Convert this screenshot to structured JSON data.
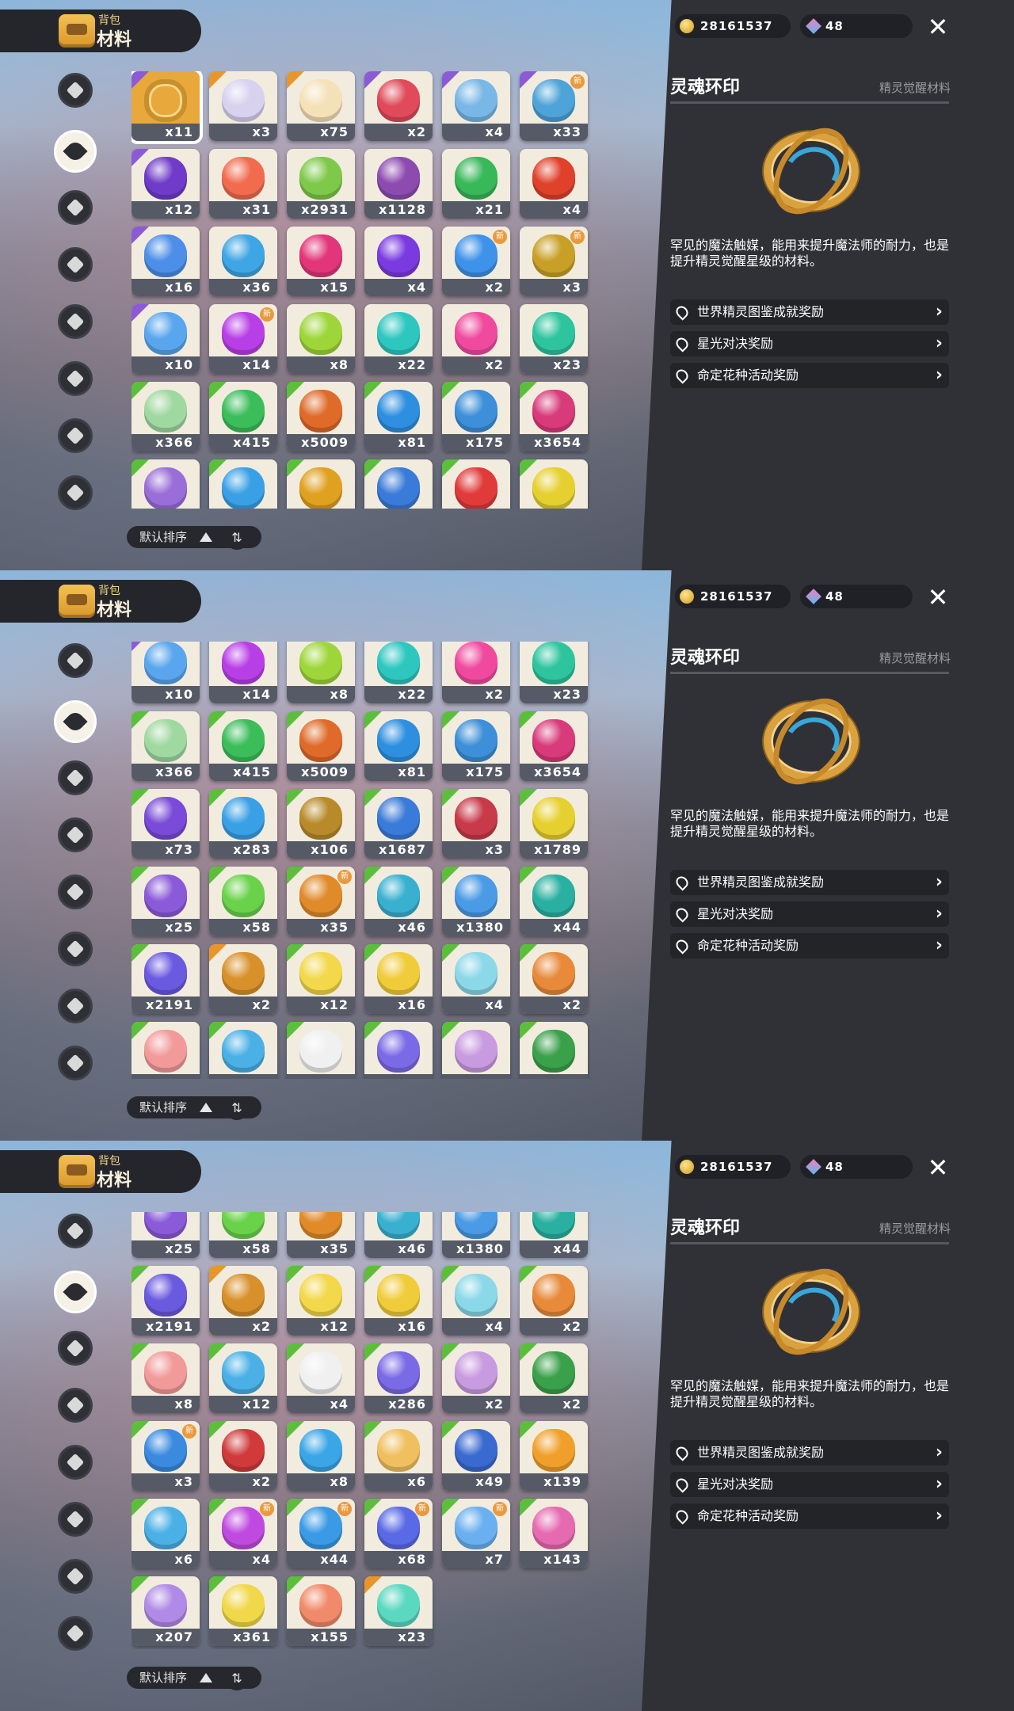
{
  "header": {
    "sub_label": "背包",
    "main_label": "材料"
  },
  "currency": {
    "coins": "28161537",
    "gems": "48"
  },
  "sort": {
    "label": "默认排序"
  },
  "detail": {
    "title": "灵魂环印",
    "category": "精灵觉醒材料",
    "description": "罕见的魔法触媒，能用来提升魔法师的耐力，也是提升精灵觉醒星级的材料。",
    "sources": [
      "世界精灵图鉴成就奖励",
      "星光对决奖励",
      "命定花种活动奖励"
    ]
  },
  "sidebar_icons": [
    "star-icon",
    "leaf-icon",
    "sparkle-icon",
    "plant-icon",
    "crown-icon",
    "ball-icon",
    "acorn-icon",
    "helmet-icon"
  ],
  "panels": [
    {
      "rows": [
        [
          [
            "x11",
            "#d9a23e",
            "purple",
            "sel",
            "ring"
          ],
          [
            "x3",
            "#d8d2ef",
            "orange"
          ],
          [
            "x75",
            "#f4e1b8",
            "orange"
          ],
          [
            "x2",
            "#e04a5a",
            "purple"
          ],
          [
            "x4",
            "#78b7e6",
            "purple"
          ],
          [
            "x33",
            "#4ea3d8",
            "purple",
            "new"
          ]
        ],
        [
          [
            "x12",
            "#6f3bc8",
            "purple"
          ],
          [
            "x31",
            "#f26b4f",
            ""
          ],
          [
            "x2931",
            "#7ec94a",
            ""
          ],
          [
            "x1128",
            "#8d4bb0",
            ""
          ],
          [
            "x21",
            "#39b85a",
            ""
          ],
          [
            "x4",
            "#e0412a",
            ""
          ]
        ],
        [
          [
            "x16",
            "#4c8ee8",
            "purple"
          ],
          [
            "x36",
            "#3ea6e4",
            ""
          ],
          [
            "x15",
            "#e2357a",
            ""
          ],
          [
            "x4",
            "#7a3ae0",
            ""
          ],
          [
            "x2",
            "#3f92ea",
            "",
            "new"
          ],
          [
            "x3",
            "#c8a028",
            "",
            "new"
          ]
        ],
        [
          [
            "x10",
            "#5aa6ee",
            "purple"
          ],
          [
            "x14",
            "#b83ee6",
            "",
            "new"
          ],
          [
            "x8",
            "#9ed63a",
            ""
          ],
          [
            "x22",
            "#2ec7c0",
            ""
          ],
          [
            "x2",
            "#f04a9e",
            ""
          ],
          [
            "x23",
            "#2ec49e",
            ""
          ]
        ],
        [
          [
            "x366",
            "#9fd8a0",
            "green"
          ],
          [
            "x415",
            "#3bbd5a",
            "green"
          ],
          [
            "x5009",
            "#e06a2a",
            "green"
          ],
          [
            "x81",
            "#2e8fe0",
            "green"
          ],
          [
            "x175",
            "#3c8fd8",
            "green"
          ],
          [
            "x3654",
            "#d83a7a",
            "green"
          ]
        ],
        [
          [
            "",
            "#9a6ed8",
            "green"
          ],
          [
            "",
            "#3aa0e6",
            "green"
          ],
          [
            "",
            "#e0a020",
            "green"
          ],
          [
            "",
            "#3a7ad8",
            "green"
          ],
          [
            "",
            "#e03a3a",
            "green"
          ],
          [
            "",
            "#e6d030",
            "green"
          ]
        ]
      ]
    },
    {
      "rows": [
        [
          [
            "x10",
            "#5aa6ee",
            "purple"
          ],
          [
            "x14",
            "#b83ee6",
            ""
          ],
          [
            "x8",
            "#9ed63a",
            ""
          ],
          [
            "x22",
            "#2ec7c0",
            ""
          ],
          [
            "x2",
            "#f04a9e",
            ""
          ],
          [
            "x23",
            "#2ec49e",
            ""
          ]
        ],
        [
          [
            "x366",
            "#9fd8a0",
            "green"
          ],
          [
            "x415",
            "#3bbd5a",
            "green"
          ],
          [
            "x5009",
            "#e06a2a",
            "green"
          ],
          [
            "x81",
            "#2e8fe0",
            "green"
          ],
          [
            "x175",
            "#3c8fd8",
            "green"
          ],
          [
            "x3654",
            "#d83a7a",
            "green"
          ]
        ],
        [
          [
            "x73",
            "#7a4ad8",
            "green"
          ],
          [
            "x283",
            "#3aa0e6",
            "green"
          ],
          [
            "x106",
            "#b88a2a",
            "green"
          ],
          [
            "x1687",
            "#3a7ad8",
            "green"
          ],
          [
            "x3",
            "#c83a4a",
            "green"
          ],
          [
            "x1789",
            "#e6d030",
            "green"
          ]
        ],
        [
          [
            "x25",
            "#8a5ad8",
            "green"
          ],
          [
            "x58",
            "#6ad24a",
            "green"
          ],
          [
            "x35",
            "#e08a2a",
            "green",
            "new"
          ],
          [
            "x46",
            "#3ab0d0",
            "green"
          ],
          [
            "x1380",
            "#4a9ae6",
            "green"
          ],
          [
            "x44",
            "#2ab0a0",
            "green"
          ]
        ],
        [
          [
            "x2191",
            "#6a5ae0",
            "green"
          ],
          [
            "x2",
            "#d8902a",
            "orange"
          ],
          [
            "x12",
            "#f2d84a",
            "green"
          ],
          [
            "x16",
            "#f0cc3a",
            "green"
          ],
          [
            "x4",
            "#8ad8e8",
            "green"
          ],
          [
            "x2",
            "#e88a3a",
            "green"
          ]
        ],
        [
          [
            "",
            "#f29a9a",
            "green"
          ],
          [
            "",
            "#4ab0e6",
            "green"
          ],
          [
            "",
            "#f0f0f0",
            "green"
          ],
          [
            "",
            "#7a6ae6",
            "green"
          ],
          [
            "",
            "#c89ae0",
            "green"
          ],
          [
            "",
            "#3aa04a",
            "green"
          ]
        ]
      ]
    },
    {
      "rows": [
        [
          [
            "x25",
            "#8a5ad8",
            "green"
          ],
          [
            "x58",
            "#6ad24a",
            "green"
          ],
          [
            "x35",
            "#e08a2a",
            "green"
          ],
          [
            "x46",
            "#3ab0d0",
            "green"
          ],
          [
            "x1380",
            "#4a9ae6",
            "green"
          ],
          [
            "x44",
            "#2ab0a0",
            "green"
          ]
        ],
        [
          [
            "x2191",
            "#6a5ae0",
            "green"
          ],
          [
            "x2",
            "#d8902a",
            "orange"
          ],
          [
            "x12",
            "#f2d84a",
            "green"
          ],
          [
            "x16",
            "#f0cc3a",
            "green"
          ],
          [
            "x4",
            "#8ad8e8",
            "green"
          ],
          [
            "x2",
            "#e88a3a",
            "green"
          ]
        ],
        [
          [
            "x8",
            "#f29a9a",
            "green"
          ],
          [
            "x12",
            "#4ab0e6",
            "green"
          ],
          [
            "x4",
            "#f0f0f0",
            "green"
          ],
          [
            "x286",
            "#7a6ae6",
            "green"
          ],
          [
            "x2",
            "#c89ae0",
            "green"
          ],
          [
            "x2",
            "#3aa04a",
            "green"
          ]
        ],
        [
          [
            "x3",
            "#3a8ae0",
            "green",
            "new"
          ],
          [
            "x2",
            "#d03a3a",
            "green"
          ],
          [
            "x8",
            "#3aa6e6",
            "green"
          ],
          [
            "x6",
            "#f0c060",
            "green"
          ],
          [
            "x49",
            "#3a6ad0",
            "green"
          ],
          [
            "x139",
            "#f0a02a",
            "green"
          ]
        ],
        [
          [
            "x6",
            "#4ab0e6",
            "green"
          ],
          [
            "x4",
            "#c04ae0",
            "green",
            "new"
          ],
          [
            "x44",
            "#3a9ae6",
            "green",
            "new"
          ],
          [
            "x68",
            "#5a6ae6",
            "green",
            "new"
          ],
          [
            "x7",
            "#6ab0f0",
            "green",
            "new"
          ],
          [
            "x143",
            "#e66ab0",
            "green"
          ]
        ],
        [
          [
            "x207",
            "#b08ae6",
            "green"
          ],
          [
            "x361",
            "#f0d84a",
            "green"
          ],
          [
            "x155",
            "#f08a6a",
            "green"
          ],
          [
            "x23",
            "#5ad8c0",
            "orange"
          ]
        ]
      ]
    }
  ]
}
